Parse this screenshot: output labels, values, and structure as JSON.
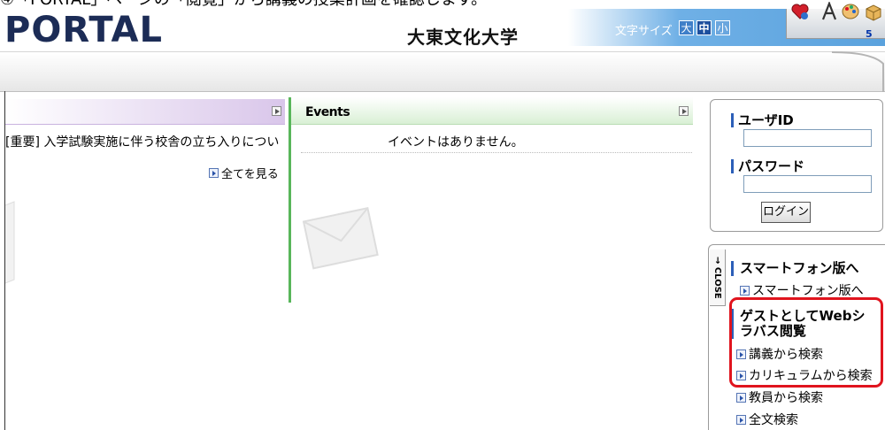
{
  "caption": "④「PORTAL」ページの「閲覧」から講義の授業計画を確認します。",
  "header": {
    "logo": "PORTAL",
    "university": "大東文化大学",
    "font_size_label": "文字サイズ",
    "font_sizes": [
      "大",
      "中",
      "小"
    ],
    "tray_badge": "5"
  },
  "announcements": {
    "item": "[重要] 入学試験実施に伴う校舎の立ち入りについ",
    "view_all": "全てを見る"
  },
  "events": {
    "title": "Events",
    "empty": "イベントはありません。"
  },
  "login": {
    "user_id_label": "ユーザID",
    "password_label": "パスワード",
    "button": "ログイン"
  },
  "side": {
    "close": "CLOSE",
    "smartphone_title": "スマートフォン版へ",
    "smartphone_link": "スマートフォン版へ",
    "guest_title": "ゲストとしてWebシラバス閲覧",
    "links": [
      "講義から検索",
      "カリキュラムから検索",
      "教員から検索",
      "全文検索"
    ]
  },
  "colors": {
    "highlight": "#e0141e",
    "events_accent": "#58b65a",
    "label_accent": "#2c5fb8"
  }
}
